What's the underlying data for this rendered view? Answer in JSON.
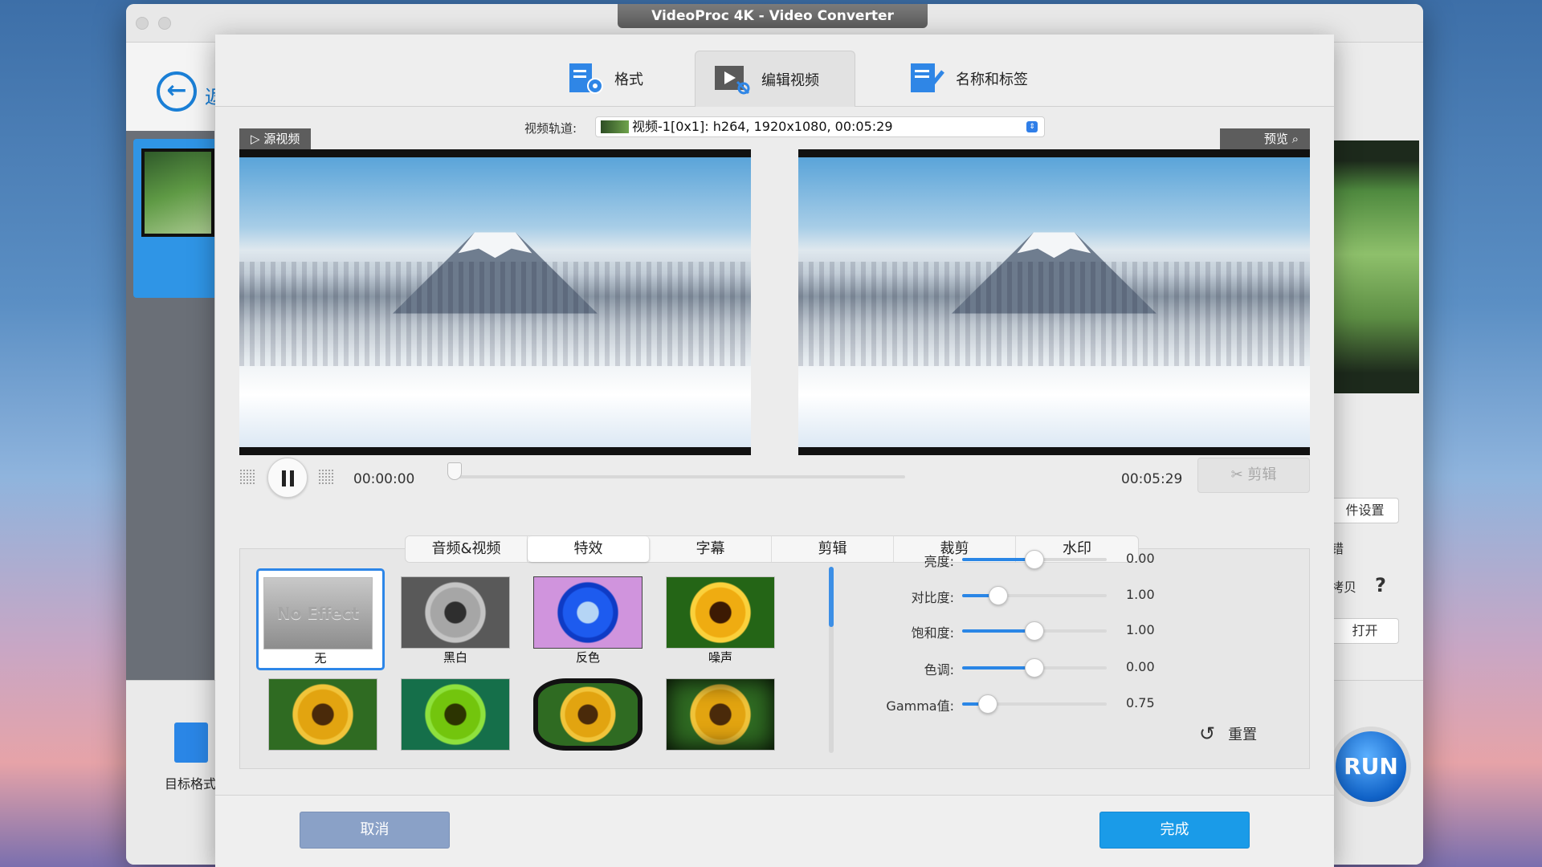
{
  "background_window": {
    "title": "VideoProc 4K - Video Converter",
    "back_label": "返",
    "right_controls": [
      "件设置",
      "错",
      "拷贝",
      "打开"
    ],
    "help": "?",
    "target_format_label": "目标格式",
    "run_label": "RUN"
  },
  "dialog": {
    "tabs": [
      {
        "label": "格式",
        "icon": "format-icon"
      },
      {
        "label": "编辑视频",
        "icon": "edit-video-icon",
        "active": true
      },
      {
        "label": "名称和标签",
        "icon": "name-tag-icon"
      }
    ],
    "track": {
      "label": "视频轨道:",
      "value": "视频-1[0x1]: h264, 1920x1080, 00:05:29"
    },
    "source_tag": "源视频",
    "preview_tag": "预览",
    "player": {
      "current_time": "00:00:00",
      "total_time": "00:05:29",
      "progress": 0,
      "cut_label": "剪辑"
    },
    "edit_tabs": [
      {
        "label": "音频&视频"
      },
      {
        "label": "特效",
        "active": true
      },
      {
        "label": "字幕"
      },
      {
        "label": "剪辑"
      },
      {
        "label": "裁剪"
      },
      {
        "label": "水印"
      }
    ],
    "effects": [
      {
        "label": "无",
        "thumb_text": "No Effect",
        "selected": true
      },
      {
        "label": "黑白"
      },
      {
        "label": "反色"
      },
      {
        "label": "噪声"
      },
      {
        "label": ""
      },
      {
        "label": ""
      },
      {
        "label": ""
      },
      {
        "label": ""
      }
    ],
    "adjustments": [
      {
        "label": "亮度:",
        "value": "0.00",
        "level": 0.5
      },
      {
        "label": "对比度:",
        "value": "1.00",
        "level": 0.25
      },
      {
        "label": "饱和度:",
        "value": "1.00",
        "level": 0.5
      },
      {
        "label": "色调:",
        "value": "0.00",
        "level": 0.5
      },
      {
        "label": "Gamma值:",
        "value": "0.75",
        "level": 0.18
      }
    ],
    "reset_label": "重置",
    "cancel_label": "取消",
    "done_label": "完成"
  },
  "colors": {
    "accent": "#1a9be8",
    "slider_fill": "#2a86e6",
    "cancel": "#8aa1c7"
  }
}
